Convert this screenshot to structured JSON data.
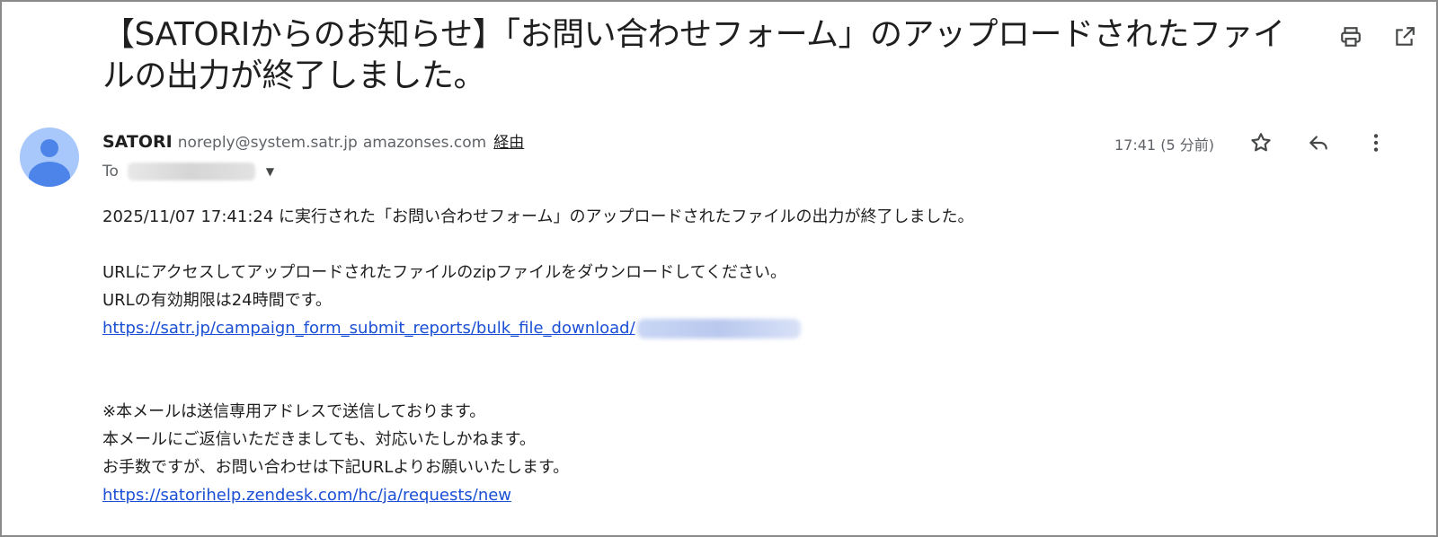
{
  "subject": "【SATORIからのお知らせ】「お問い合わせフォーム」のアップロードされたファイルの出力が終了しました。",
  "sender": {
    "name": "SATORI",
    "email": "noreply@system.satr.jp",
    "via_domain": "amazonses.com",
    "via_label": "経由"
  },
  "recipient": {
    "to_label": "To"
  },
  "time": "17:41 (5 分前)",
  "icons": {
    "print": "print-icon",
    "open_new": "open-in-new-window-icon",
    "star": "star-icon",
    "reply": "reply-icon",
    "more": "more-vertical-icon",
    "avatar": "avatar-icon",
    "dropdown": "chevron-down-icon"
  },
  "body": {
    "line1": "2025/11/07 17:41:24 に実行された「お問い合わせフォーム」のアップロードされたファイルの出力が終了しました。",
    "line2": "URLにアクセスしてアップロードされたファイルのzipファイルをダウンロードしてください。",
    "line3": "URLの有効期限は24時間です。",
    "download_link": "https://satr.jp/campaign_form_submit_reports/bulk_file_download/",
    "note1": "※本メールは送信専用アドレスで送信しております。",
    "note2": "本メールにご返信いただきましても、対応いたしかねます。",
    "note3": "お手数ですが、お問い合わせは下記URLよりお願いいたします。",
    "help_link": "https://satorihelp.zendesk.com/hc/ja/requests/new"
  },
  "colors": {
    "link": "#1a4fd6",
    "avatar_bg": "#a8c7fa",
    "avatar_fg": "#4d84ea"
  }
}
